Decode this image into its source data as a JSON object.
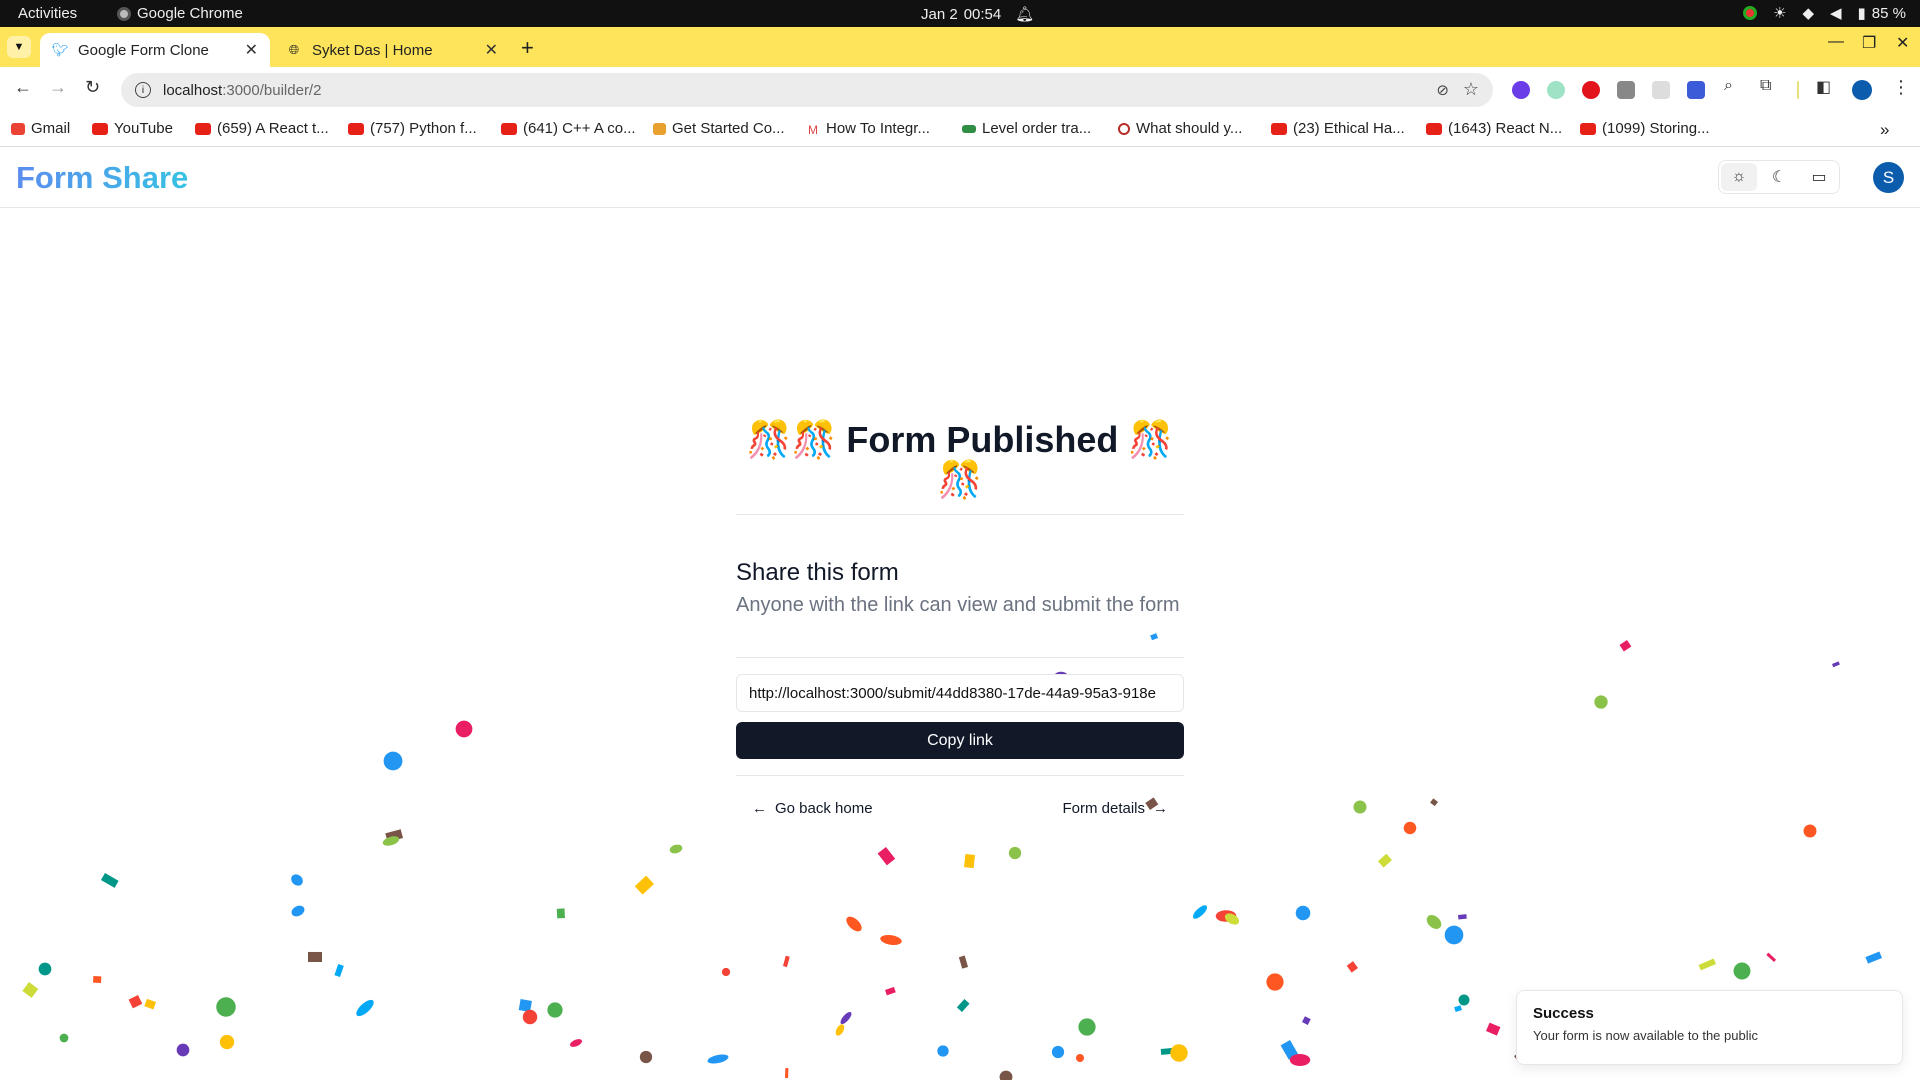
{
  "os": {
    "activities": "Activities",
    "app_name": "Google Chrome",
    "date": "Jan 2",
    "time": "00:54",
    "battery": "85 %"
  },
  "tabs": [
    {
      "title": "Google Form Clone",
      "active": true
    },
    {
      "title": "Syket Das | Home",
      "active": false
    }
  ],
  "address": {
    "host": "localhost",
    "path": ":3000/builder/2"
  },
  "bookmarks": [
    {
      "label": "Gmail",
      "icon": "gmail-icon"
    },
    {
      "label": "YouTube",
      "icon": "youtube-icon"
    },
    {
      "label": "(659) A React t...",
      "icon": "youtube-icon"
    },
    {
      "label": "(757) Python f...",
      "icon": "youtube-icon"
    },
    {
      "label": "(641) C++ A co...",
      "icon": "youtube-icon"
    },
    {
      "label": "Get Started Co...",
      "icon": "puzzle-icon"
    },
    {
      "label": "How To Integr...",
      "icon": "medium-icon"
    },
    {
      "label": "Level order tra...",
      "icon": "gfg-icon"
    },
    {
      "label": "What should y...",
      "icon": "quora-icon"
    },
    {
      "label": "(23) Ethical Ha...",
      "icon": "youtube-icon"
    },
    {
      "label": "(1643) React N...",
      "icon": "youtube-icon"
    },
    {
      "label": "(1099) Storing...",
      "icon": "youtube-icon"
    }
  ],
  "app": {
    "logo": "Form Share",
    "avatar_letter": "S"
  },
  "main": {
    "title_line1": "🎊🎊 Form Published 🎊",
    "title_line2": "🎊",
    "share_title": "Share this form",
    "share_desc": "Anyone with the link can view and submit the form",
    "link": "http://localhost:3000/submit/44dd8380-17de-44a9-95a3-918e",
    "copy_label": "Copy link",
    "back_label": "Go back home",
    "details_label": "Form details"
  },
  "toast": {
    "title": "Success",
    "desc": "Your form is now available to the public"
  },
  "colors": {
    "tabstrip": "#fde45a",
    "primary_button": "#111827",
    "logo_gradient_start": "#5b8def",
    "logo_gradient_end": "#36c2e3"
  }
}
